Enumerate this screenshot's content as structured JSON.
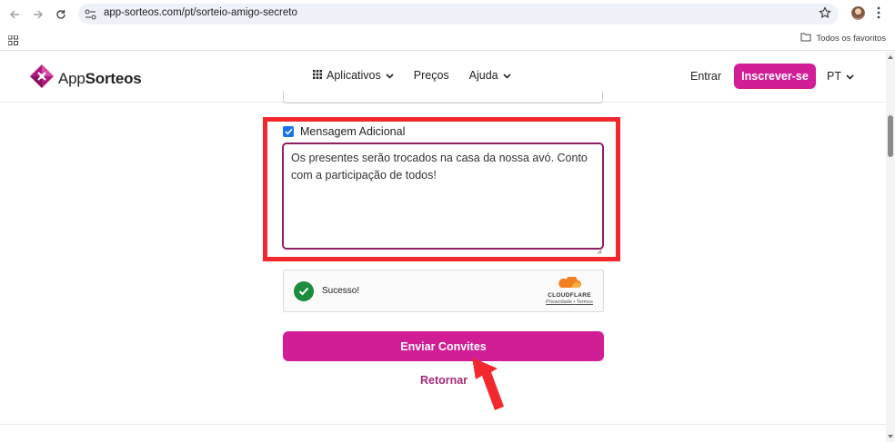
{
  "browser": {
    "url": "app-sorteos.com/pt/sorteio-amigo-secreto",
    "bookmark_folder": "Todos os favoritos",
    "icons": [
      "back-arrow-icon",
      "forward-arrow-icon",
      "reload-icon",
      "site-settings-icon",
      "bookmark-star-icon",
      "profile-avatar",
      "more-menu-icon",
      "apps-grid-icon",
      "folder-icon"
    ]
  },
  "header": {
    "logo_prefix": "App",
    "logo_suffix": "Sorteos",
    "nav": {
      "apps_label": "Aplicativos",
      "prices_label": "Preços",
      "help_label": "Ajuda"
    },
    "login_label": "Entrar",
    "signup_label": "Inscrever-se",
    "language_label": "PT"
  },
  "form": {
    "message_checkbox_checked": true,
    "message_label": "Mensagem Adicional",
    "message_value": "Os presentes serão trocados na casa da nossa avó. Conto com a participação de todos!",
    "captcha": {
      "status_text": "Sucesso!",
      "brand": "CLOUDFLARE",
      "privacy_label": "Privacidade",
      "separator": "•",
      "terms_label": "Termos"
    },
    "submit_label": "Enviar Convites",
    "back_label": "Retornar"
  },
  "colors": {
    "brand_pink": "#d21e96",
    "highlight_red": "#f3282e",
    "textarea_border": "#8e1f63",
    "success_green": "#1c8c3e",
    "checkbox_blue": "#1a73e8"
  }
}
